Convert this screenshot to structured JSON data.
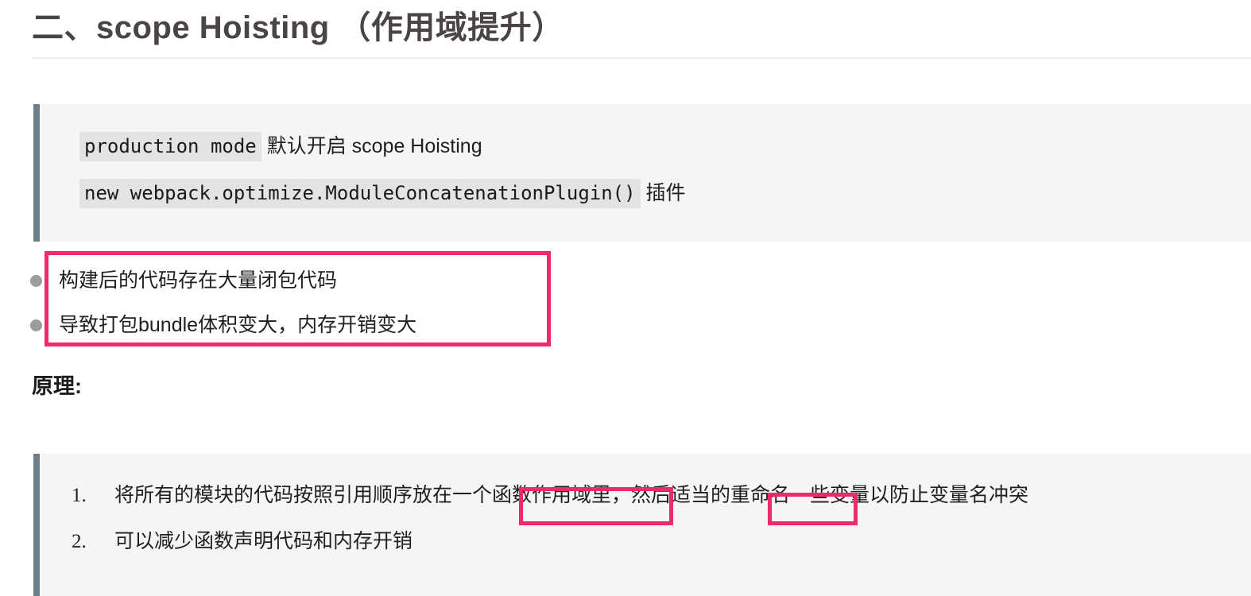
{
  "page": {
    "title": "二、scope Hoisting （作用域提升）",
    "background_color": "#ffffff",
    "accent_color": "#ee2a6b",
    "quote_border_color": "#6e7f89",
    "quote_background_color": "#f5f5f5",
    "code_chip_color": "#e3e3e3"
  },
  "quote_one": {
    "line1": {
      "code": "production mode",
      "text": " 默认开启 scope Hoisting"
    },
    "line2": {
      "code": "new webpack.optimize.ModuleConcatenationPlugin()",
      "text": " 插件"
    }
  },
  "bullets": [
    {
      "text": "构建后的代码存在大量闭包代码"
    },
    {
      "text": "导致打包bundle体积变大，内存开销变大"
    }
  ],
  "section_heading": "原理:",
  "quote_two": {
    "items": [
      {
        "number": "1.",
        "text": "将所有的模块的代码按照引用顺序放在一个函数作用域里，然后适当的重命名一些变量以防止变量名冲突"
      },
      {
        "number": "2.",
        "text": "可以减少函数声明代码和内存开销"
      }
    ]
  },
  "annotations": [
    {
      "label": "highlight-bullets",
      "color": "#ee2a6b"
    },
    {
      "label": "highlight-function-scope",
      "color": "#ee2a6b"
    },
    {
      "label": "highlight-rename",
      "color": "#ee2a6b"
    }
  ]
}
